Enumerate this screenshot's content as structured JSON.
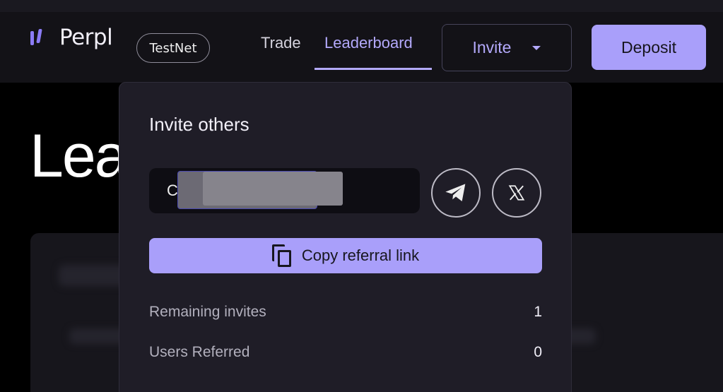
{
  "header": {
    "brand": "Perpl",
    "network_badge": "TestNet",
    "nav": [
      {
        "label": "Trade",
        "active": false
      },
      {
        "label": "Leaderboard",
        "active": true
      }
    ],
    "invite_label": "Invite",
    "deposit_label": "Deposit"
  },
  "page": {
    "heading_partial": "Lea"
  },
  "invite_dropdown": {
    "title": "Invite others",
    "referral_input_value": "C",
    "copy_label": "Copy referral link",
    "stats": [
      {
        "label": "Remaining invites",
        "value": "1"
      },
      {
        "label": "Users Referred",
        "value": "0"
      }
    ]
  },
  "colors": {
    "accent": "#a99ffa",
    "accent_text": "#b3a9fb",
    "background": "#000000",
    "navbar": "#131217",
    "dropdown": "#1f1d27"
  },
  "icons": {
    "telegram": "telegram-icon",
    "x": "x-logo-icon",
    "copy": "copy-icon",
    "caret": "chevron-down-icon"
  }
}
